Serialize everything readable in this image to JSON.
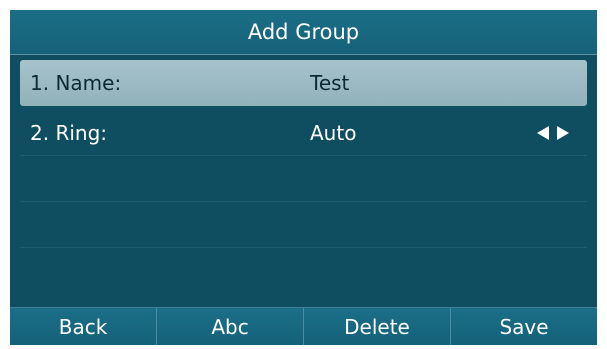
{
  "screen": {
    "title": "Add Group",
    "fields": [
      {
        "label": "1. Name:",
        "value": "Test",
        "selected": true
      },
      {
        "label": "2. Ring:",
        "value": "Auto",
        "selected": false,
        "arrows": [
          "caret-left-icon",
          "caret-right-icon"
        ]
      }
    ]
  },
  "softkeys": [
    {
      "label": "Back"
    },
    {
      "label": "Abc"
    },
    {
      "label": "Delete"
    },
    {
      "label": "Save"
    }
  ],
  "colors": {
    "screen_bg": "#0f4d60",
    "titlebar_bg": "#15627a",
    "selected_row_bg": "#a7c3cc",
    "text": "#ffffff"
  }
}
